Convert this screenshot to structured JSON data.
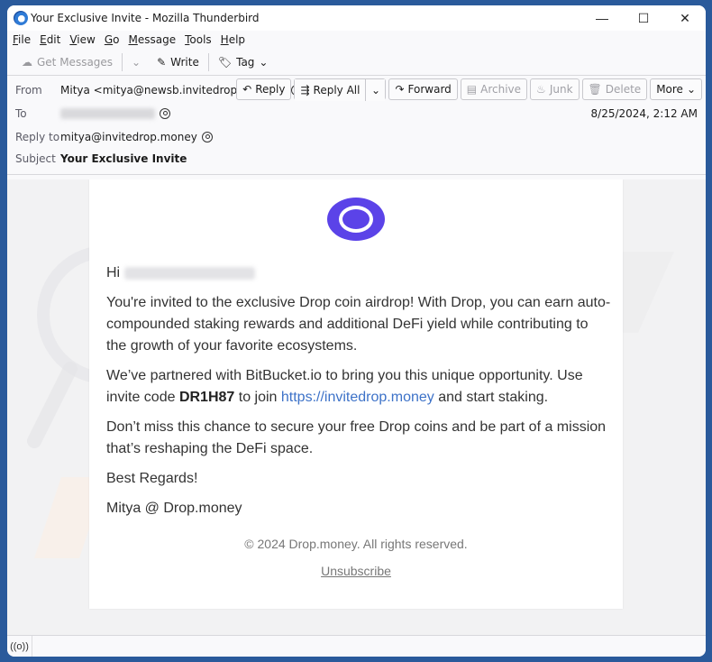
{
  "window": {
    "title": "Your Exclusive Invite - Mozilla Thunderbird",
    "controls": {
      "minimize": "—",
      "maximize": "☐",
      "close": "✕"
    }
  },
  "menubar": {
    "items": [
      {
        "label": "File",
        "accel": "F"
      },
      {
        "label": "Edit",
        "accel": "E"
      },
      {
        "label": "View",
        "accel": "V"
      },
      {
        "label": "Go",
        "accel": "G"
      },
      {
        "label": "Message",
        "accel": "M"
      },
      {
        "label": "Tools",
        "accel": "T"
      },
      {
        "label": "Help",
        "accel": "H"
      }
    ]
  },
  "toolbar": {
    "get_messages": "Get Messages",
    "write": "Write",
    "tag": "Tag"
  },
  "header": {
    "from_label": "From",
    "from_value": "Mitya <mitya@newsb.invitedrop.money>",
    "to_label": "To",
    "to_value": "",
    "reply_to_label": "Reply to",
    "reply_to_value": "mitya@invitedrop.money",
    "subject_label": "Subject",
    "subject_value": "Your Exclusive Invite",
    "date": "8/25/2024, 2:12 AM"
  },
  "actions": {
    "reply": "Reply",
    "reply_all": "Reply All",
    "forward": "Forward",
    "archive": "Archive",
    "junk": "Junk",
    "delete": "Delete",
    "more": "More"
  },
  "email": {
    "brand_color": "#5b43e8",
    "greeting": "Hi",
    "p1": "You're invited to the exclusive Drop coin airdrop! With Drop, you can earn auto-compounded staking rewards and additional DeFi yield while contributing to the growth of your favorite ecosystems.",
    "p2_a": "We’ve partnered with BitBucket.io to bring you this unique opportunity. Use invite code ",
    "p2_code": "DR1H87",
    "p2_b": " to join ",
    "p2_link": "https://invitedrop.money",
    "p2_c": " and start staking.",
    "p3": "Don’t miss this chance to secure your free Drop coins and be part of a mission that’s reshaping the DeFi space.",
    "p4": "Best Regards!",
    "p5": "Mitya @ Drop.money",
    "copyright": "© 2024 Drop.money. All rights reserved.",
    "unsubscribe": "Unsubscribe"
  },
  "statusbar": {
    "icon": "((o))"
  }
}
